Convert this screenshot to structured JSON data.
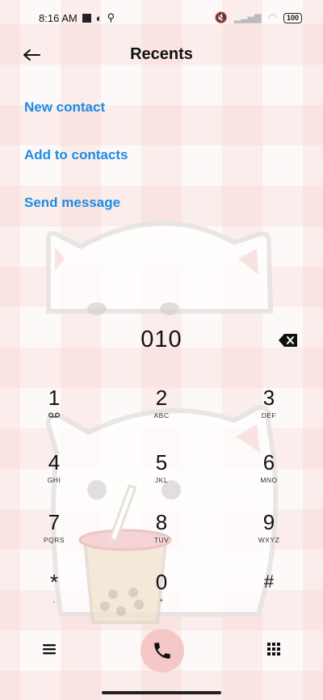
{
  "status_bar": {
    "time": "8:16 AM",
    "battery": "100",
    "icons": [
      "media-icon",
      "vpn-icon",
      "location-icon",
      "mute-icon",
      "signal-icon",
      "wifi-icon",
      "battery-icon"
    ]
  },
  "header": {
    "title": "Recents",
    "back_icon": "back-arrow-icon"
  },
  "actions": [
    {
      "label": "New contact"
    },
    {
      "label": "Add to contacts"
    },
    {
      "label": "Send message"
    }
  ],
  "dialed_number": "010",
  "keypad": [
    {
      "digit": "1",
      "letters": "☉"
    },
    {
      "digit": "2",
      "letters": "ABC"
    },
    {
      "digit": "3",
      "letters": "DEF"
    },
    {
      "digit": "4",
      "letters": "GHI"
    },
    {
      "digit": "5",
      "letters": "JKL"
    },
    {
      "digit": "6",
      "letters": "MNO"
    },
    {
      "digit": "7",
      "letters": "PQRS"
    },
    {
      "digit": "8",
      "letters": "TUV"
    },
    {
      "digit": "9",
      "letters": "WXYZ"
    },
    {
      "digit": "*",
      "letters": ","
    },
    {
      "digit": "0",
      "letters": "+"
    },
    {
      "digit": "#",
      "letters": ""
    }
  ],
  "colors": {
    "accent": "#1c8ce6",
    "call_button": "#f6c7c7",
    "text": "#111111"
  }
}
